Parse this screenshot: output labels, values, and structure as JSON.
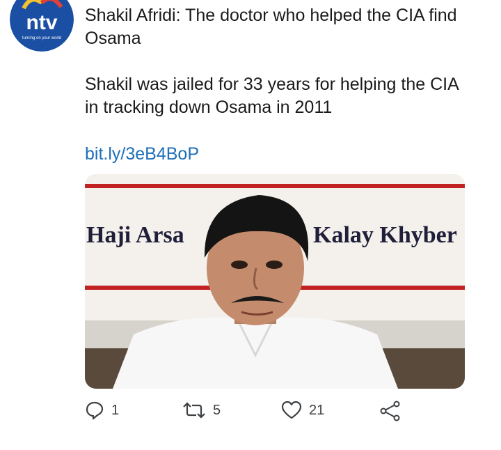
{
  "account": {
    "avatar_logo_text": "ntv",
    "avatar_logo_tagline": "turning on your world"
  },
  "tweet": {
    "headline": "Shakil Afridi: The doctor who helped the CIA find Osama",
    "body": "Shakil was jailed for 33 years for helping the CIA in tracking down Osama in 2011",
    "link": "bit.ly/3eB4BoP"
  },
  "media": {
    "banner_text_left": "Haji Arsa",
    "banner_text_right": "Kalay Khyber"
  },
  "actions": {
    "reply_count": "1",
    "retweet_count": "5",
    "like_count": "21"
  },
  "colors": {
    "link": "#1d6fb8",
    "logo_blue": "#1a4fa3",
    "icon_gray": "#3c4043",
    "banner_red": "#c22222"
  },
  "icons": [
    "reply-icon",
    "retweet-icon",
    "like-icon",
    "share-icon"
  ]
}
